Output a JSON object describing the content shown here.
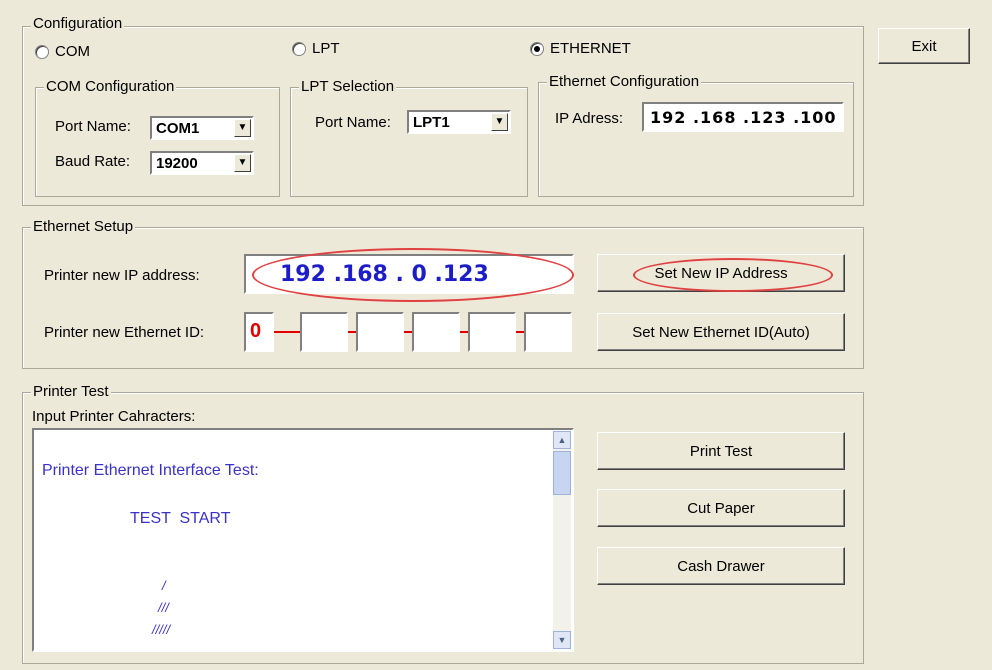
{
  "configuration": {
    "title": "Configuration",
    "radios": [
      {
        "label": "COM",
        "checked": false
      },
      {
        "label": "LPT",
        "checked": false
      },
      {
        "label": "ETHERNET",
        "checked": true
      }
    ],
    "com": {
      "title": "COM Configuration",
      "port_label": "Port Name:",
      "port_value": "COM1",
      "baud_label": "Baud Rate:",
      "baud_value": "19200"
    },
    "lpt": {
      "title": "LPT Selection",
      "port_label": "Port Name:",
      "port_value": "LPT1"
    },
    "ethernet": {
      "title": "Ethernet Configuration",
      "ip_label": "IP Adress:",
      "ip_value": "192 .168 .123 .100"
    }
  },
  "exit_button": "Exit",
  "ethernet_setup": {
    "title": "Ethernet Setup",
    "new_ip_label": "Printer new IP address:",
    "new_ip_value": "192 .168 .  0  .123",
    "new_id_label": "Printer new Ethernet ID:",
    "id_boxes": [
      "0",
      "",
      "",
      "",
      "",
      ""
    ],
    "set_ip_button": "Set New IP Address",
    "set_id_button": "Set New Ethernet ID(Auto)"
  },
  "printer_test": {
    "title": "Printer Test",
    "input_label": "Input Printer Cahracters:",
    "lines": [
      "Printer Ethernet Interface Test:",
      "TEST  START",
      "/",
      "///",
      "/////"
    ],
    "buttons": [
      "Print Test",
      "Cut Paper",
      "Cash Drawer"
    ]
  },
  "colors": {
    "dialog_bg": "#ece9d8",
    "annotation": "#e04040",
    "ip_text": "#1c1cc8",
    "id_red": "#e00000",
    "test_text": "#3a32c8"
  }
}
